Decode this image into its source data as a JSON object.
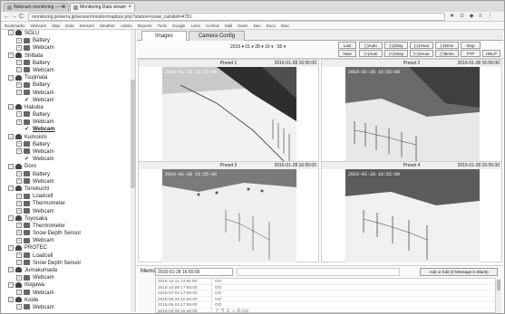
{
  "browser": {
    "tabs": [
      {
        "label": "Webcam monitoring — ru"
      },
      {
        "label": "Monitoring Data viewer"
      }
    ],
    "back": "←",
    "forward": "→",
    "reload": "C",
    "url": "monitoring.proterra.jp/sensor/monitor/mapbox.php?station=snow_cam&id=4781",
    "ext_icons": "★ ⊙ ◆ ≡ ⋮",
    "bookmarks": [
      "Bookmarks",
      "Webcam",
      "Map",
      "Data",
      "Sensors",
      "Weather",
      "Admin",
      "Reports",
      "Tools",
      "Google",
      "Links",
      "Archive",
      "Mail",
      "News",
      "Dev",
      "Docs",
      "Misc"
    ]
  },
  "sidebar": {
    "tree": [
      {
        "level": 0,
        "kind": "station",
        "label": "SOLU"
      },
      {
        "level": 1,
        "kind": "sensor",
        "label": "Battery"
      },
      {
        "level": 1,
        "kind": "sensor",
        "label": "Webcam"
      },
      {
        "level": 0,
        "kind": "station",
        "label": "Shibata"
      },
      {
        "level": 1,
        "kind": "sensor",
        "label": "Battery"
      },
      {
        "level": 1,
        "kind": "sensor",
        "label": "Webcam"
      },
      {
        "level": 0,
        "kind": "station",
        "label": "Tsujimata"
      },
      {
        "level": 1,
        "kind": "sensor",
        "label": "Battery"
      },
      {
        "level": 1,
        "kind": "sensor",
        "label": "Webcam"
      },
      {
        "level": 2,
        "kind": "check",
        "label": "Webcam"
      },
      {
        "level": 0,
        "kind": "station",
        "label": "Hakuba"
      },
      {
        "level": 1,
        "kind": "sensor",
        "label": "Battery"
      },
      {
        "level": 1,
        "kind": "sensor",
        "label": "Webcam"
      },
      {
        "level": 2,
        "kind": "check",
        "label": "Webcam",
        "selected": true
      },
      {
        "level": 0,
        "kind": "station",
        "label": "Kumoishi"
      },
      {
        "level": 1,
        "kind": "sensor",
        "label": "Battery"
      },
      {
        "level": 1,
        "kind": "sensor",
        "label": "Webcam"
      },
      {
        "level": 2,
        "kind": "check",
        "label": "Webcam"
      },
      {
        "level": 0,
        "kind": "station",
        "label": "Doro"
      },
      {
        "level": 1,
        "kind": "sensor",
        "label": "Battery"
      },
      {
        "level": 1,
        "kind": "sensor",
        "label": "Webcam"
      },
      {
        "level": 0,
        "kind": "station",
        "label": "Tenokuchi"
      },
      {
        "level": 1,
        "kind": "sensor",
        "label": "Loadcell"
      },
      {
        "level": 1,
        "kind": "sensor",
        "label": "Thermometer"
      },
      {
        "level": 1,
        "kind": "sensor",
        "label": "Webcam"
      },
      {
        "level": 0,
        "kind": "station",
        "label": "Toyosaka"
      },
      {
        "level": 1,
        "kind": "sensor",
        "label": "Thermometer"
      },
      {
        "level": 1,
        "kind": "sensor",
        "label": "Snow Depth Sensor"
      },
      {
        "level": 1,
        "kind": "sensor",
        "label": "Webcam"
      },
      {
        "level": 0,
        "kind": "station",
        "label": "PROTEC"
      },
      {
        "level": 1,
        "kind": "sensor",
        "label": "Loadcell"
      },
      {
        "level": 1,
        "kind": "sensor",
        "label": "Snow Depth Sensor"
      },
      {
        "level": 0,
        "kind": "station",
        "label": "Jumakumada"
      },
      {
        "level": 1,
        "kind": "sensor",
        "label": "Webcam"
      },
      {
        "level": 0,
        "kind": "station",
        "label": "Itsigawa"
      },
      {
        "level": 1,
        "kind": "sensor",
        "label": "Webcam"
      },
      {
        "level": 0,
        "kind": "station",
        "label": "Koide"
      },
      {
        "level": 1,
        "kind": "sensor",
        "label": "Webcam"
      }
    ]
  },
  "tabs": [
    {
      "label": "Images",
      "active": true
    },
    {
      "label": "Camera Config",
      "active": false
    }
  ],
  "controls": {
    "date_line": "2016 ▾ 01 ▾ 28 ▾ 16 ▾ : 55 ▾",
    "buttons": {
      "last": "Last",
      "now": "Now",
      "prev_auto": "(-)Auto",
      "next_auto": "(+)Auto",
      "prev_day": "(-)1Day",
      "next_day": "(+)1Day",
      "prev_hour": "(-)1Hour",
      "next_hour": "(+)1Hour",
      "prev_5min": "(-)5min",
      "next_5min": "(+)5min",
      "stop": "Stop",
      "ftp": "FTP",
      "help": "HELP"
    }
  },
  "presets": [
    {
      "label": "Preset 1",
      "timestamp": "2016-01-28 16:55:00",
      "stamp": "2016-01-28 16:55:00"
    },
    {
      "label": "Preset 2",
      "timestamp": "2016-01-28 16:55:00",
      "stamp": "2016-01-28 16:55:00"
    },
    {
      "label": "Preset 3",
      "timestamp": "2016-01-28 16:55:00",
      "stamp": "2016-01-28 16:55:00"
    },
    {
      "label": "Preset 4",
      "timestamp": "2016-01-28 16:55:00",
      "stamp": "2016-01-28 16:55:00"
    }
  ],
  "memo": {
    "label": "Memo:",
    "input_value": "2016-01-28 16:55:00",
    "add_button": "Add or Edit (if Message is Blank)",
    "log": [
      {
        "date": "2015-12-11 13:55:00",
        "msg": "OO"
      },
      {
        "date": "2015-10-09 17:55:00",
        "msg": "OO"
      },
      {
        "date": "2015-07-02 17:55:00",
        "msg": "OO"
      },
      {
        "date": "2015-06-25 10:05:00",
        "msg": "OO"
      },
      {
        "date": "2015-06-04 17:55:00",
        "msg": "OO"
      },
      {
        "date": "2015-02-05 15:45:00",
        "msg": "ア ラ ス ッ の OO"
      }
    ]
  }
}
